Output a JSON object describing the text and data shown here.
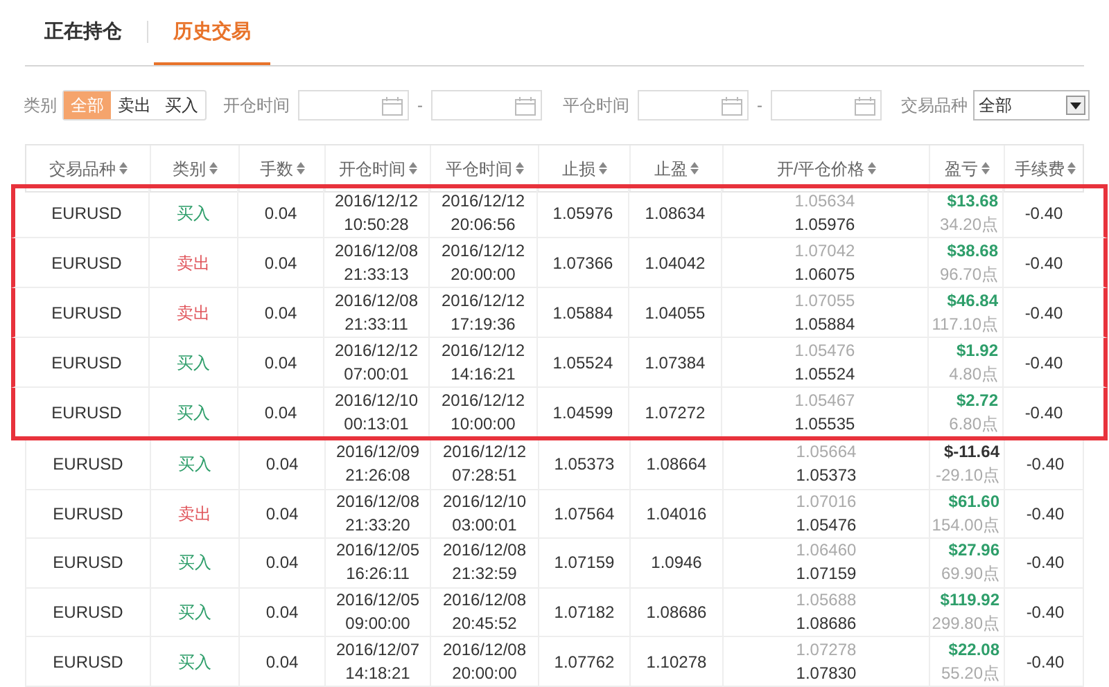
{
  "tabs": [
    {
      "label": "正在持仓",
      "selected": false
    },
    {
      "label": "历史交易",
      "selected": true
    }
  ],
  "filters": {
    "type_label": "类别",
    "type_options": [
      {
        "label": "全部",
        "selected": true
      },
      {
        "label": "卖出",
        "selected": false
      },
      {
        "label": "买入",
        "selected": false
      }
    ],
    "open_time_label": "开仓时间",
    "range_separator_1": "-",
    "close_time_label": "平仓时间",
    "range_separator_2": "-",
    "symbol_label": "交易品种",
    "symbol_value": "全部"
  },
  "table": {
    "columns": [
      "交易品种",
      "类别",
      "手数",
      "开仓时间",
      "平仓时间",
      "止损",
      "止盈",
      "开/平仓价格",
      "盈亏",
      "手续费"
    ],
    "rows": [
      {
        "symbol": "EURUSD",
        "type": {
          "text": "买入",
          "kind": "buy"
        },
        "lots": "0.04",
        "open_date": "2016/12/12",
        "open_time": "10:50:28",
        "close_date": "2016/12/12",
        "close_time": "20:06:56",
        "stop_loss": "1.05976",
        "take_profit": "1.08634",
        "open_price": "1.05634",
        "close_price": "1.05976",
        "profit": {
          "text": "$13.68",
          "kind": "gain"
        },
        "points": "34.20点",
        "fee": "-0.40",
        "highlighted": true
      },
      {
        "symbol": "EURUSD",
        "type": {
          "text": "卖出",
          "kind": "sell"
        },
        "lots": "0.04",
        "open_date": "2016/12/08",
        "open_time": "21:33:13",
        "close_date": "2016/12/12",
        "close_time": "20:00:00",
        "stop_loss": "1.07366",
        "take_profit": "1.04042",
        "open_price": "1.07042",
        "close_price": "1.06075",
        "profit": {
          "text": "$38.68",
          "kind": "gain"
        },
        "points": "96.70点",
        "fee": "-0.40",
        "highlighted": true
      },
      {
        "symbol": "EURUSD",
        "type": {
          "text": "卖出",
          "kind": "sell"
        },
        "lots": "0.04",
        "open_date": "2016/12/08",
        "open_time": "21:33:11",
        "close_date": "2016/12/12",
        "close_time": "17:19:36",
        "stop_loss": "1.05884",
        "take_profit": "1.04055",
        "open_price": "1.07055",
        "close_price": "1.05884",
        "profit": {
          "text": "$46.84",
          "kind": "gain"
        },
        "points": "117.10点",
        "fee": "-0.40",
        "highlighted": true
      },
      {
        "symbol": "EURUSD",
        "type": {
          "text": "买入",
          "kind": "buy"
        },
        "lots": "0.04",
        "open_date": "2016/12/12",
        "open_time": "07:00:01",
        "close_date": "2016/12/12",
        "close_time": "14:16:21",
        "stop_loss": "1.05524",
        "take_profit": "1.07384",
        "open_price": "1.05476",
        "close_price": "1.05524",
        "profit": {
          "text": "$1.92",
          "kind": "gain"
        },
        "points": "4.80点",
        "fee": "-0.40",
        "highlighted": true
      },
      {
        "symbol": "EURUSD",
        "type": {
          "text": "买入",
          "kind": "buy"
        },
        "lots": "0.04",
        "open_date": "2016/12/10",
        "open_time": "00:13:01",
        "close_date": "2016/12/12",
        "close_time": "10:00:00",
        "stop_loss": "1.04599",
        "take_profit": "1.07272",
        "open_price": "1.05467",
        "close_price": "1.05535",
        "profit": {
          "text": "$2.72",
          "kind": "gain"
        },
        "points": "6.80点",
        "fee": "-0.40",
        "highlighted": true
      },
      {
        "symbol": "EURUSD",
        "type": {
          "text": "买入",
          "kind": "buy"
        },
        "lots": "0.04",
        "open_date": "2016/12/09",
        "open_time": "21:26:08",
        "close_date": "2016/12/12",
        "close_time": "07:28:51",
        "stop_loss": "1.05373",
        "take_profit": "1.08664",
        "open_price": "1.05664",
        "close_price": "1.05373",
        "profit": {
          "text": "$-11.64",
          "kind": "loss"
        },
        "points": "-29.10点",
        "fee": "-0.40",
        "highlighted": false
      },
      {
        "symbol": "EURUSD",
        "type": {
          "text": "卖出",
          "kind": "sell"
        },
        "lots": "0.04",
        "open_date": "2016/12/08",
        "open_time": "21:33:20",
        "close_date": "2016/12/10",
        "close_time": "03:00:01",
        "stop_loss": "1.07564",
        "take_profit": "1.04016",
        "open_price": "1.07016",
        "close_price": "1.05476",
        "profit": {
          "text": "$61.60",
          "kind": "gain"
        },
        "points": "154.00点",
        "fee": "-0.40",
        "highlighted": false
      },
      {
        "symbol": "EURUSD",
        "type": {
          "text": "买入",
          "kind": "buy"
        },
        "lots": "0.04",
        "open_date": "2016/12/05",
        "open_time": "16:26:11",
        "close_date": "2016/12/08",
        "close_time": "21:32:59",
        "stop_loss": "1.07159",
        "take_profit": "1.0946",
        "open_price": "1.06460",
        "close_price": "1.07159",
        "profit": {
          "text": "$27.96",
          "kind": "gain"
        },
        "points": "69.90点",
        "fee": "-0.40",
        "highlighted": false
      },
      {
        "symbol": "EURUSD",
        "type": {
          "text": "买入",
          "kind": "buy"
        },
        "lots": "0.04",
        "open_date": "2016/12/05",
        "open_time": "09:00:00",
        "close_date": "2016/12/08",
        "close_time": "20:45:52",
        "stop_loss": "1.07182",
        "take_profit": "1.08686",
        "open_price": "1.05688",
        "close_price": "1.08686",
        "profit": {
          "text": "$119.92",
          "kind": "gain"
        },
        "points": "299.80点",
        "fee": "-0.40",
        "highlighted": false
      },
      {
        "symbol": "EURUSD",
        "type": {
          "text": "买入",
          "kind": "buy"
        },
        "lots": "0.04",
        "open_date": "2016/12/07",
        "open_time": "14:18:21",
        "close_date": "2016/12/08",
        "close_time": "20:00:00",
        "stop_loss": "1.07762",
        "take_profit": "1.10278",
        "open_price": "1.07278",
        "close_price": "1.07830",
        "profit": {
          "text": "$22.08",
          "kind": "gain"
        },
        "points": "55.20点",
        "fee": "-0.40",
        "highlighted": false
      }
    ]
  }
}
